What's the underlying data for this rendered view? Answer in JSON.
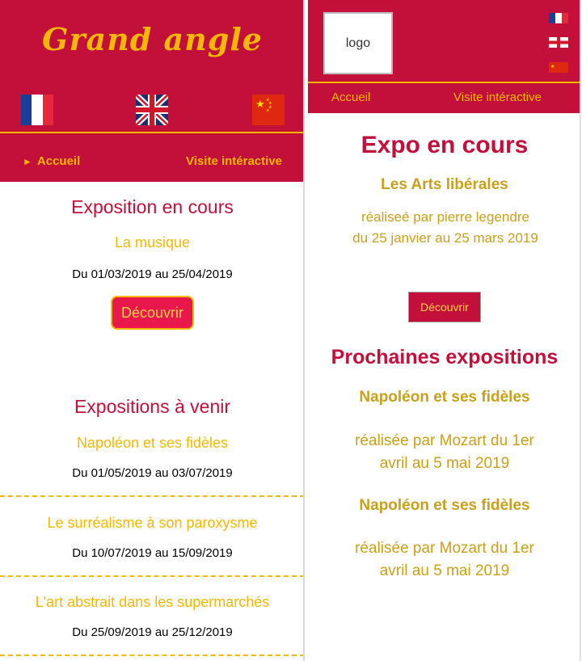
{
  "left": {
    "brand": "Grand angle",
    "flags": [
      "french-flag",
      "uk-flag",
      "china-flag"
    ],
    "nav": {
      "home": "Accueil",
      "visit": "Visite intéractive",
      "home_marker": "►"
    },
    "current": {
      "section_title": "Exposition en cours",
      "name": "La musique",
      "dates": "Du 01/03/2019 au 25/04/2019",
      "button": "Découvrir"
    },
    "upcoming": {
      "section_title": "Expositions à venir",
      "items": [
        {
          "name": "Napoléon et ses fidèles",
          "dates": "Du 01/05/2019 au 03/07/2019"
        },
        {
          "name": "Le surréalisme à son paroxysme",
          "dates": "Du 10/07/2019 au 15/09/2019"
        },
        {
          "name": "L'art abstrait dans les supermarchés",
          "dates": "Du 25/09/2019 au 25/12/2019"
        }
      ]
    }
  },
  "right": {
    "logo": "logo",
    "flags": [
      "french-flag",
      "england-flag",
      "china-flag"
    ],
    "nav": {
      "home": "Accueil",
      "visit": "Visite intéractive"
    },
    "current": {
      "section_title": "Expo en cours",
      "name": "Les Arts libérales",
      "description": "réaliseé par pierre legendre du 25 janvier au 25 mars 2019",
      "button": "Découvrir"
    },
    "upcoming": {
      "section_title": "Prochaines expositions",
      "items": [
        {
          "name": "Napoléon et ses fidèles",
          "description": "réalisée par Mozart du 1er avril au 5 mai 2019"
        },
        {
          "name": "Napoléon et ses fidèles",
          "description": "réalisée par Mozart du 1er avril au 5 mai 2019"
        }
      ]
    }
  },
  "colors": {
    "crimson": "#c2103b",
    "gold": "#f5b800",
    "dark_gold": "#c9a01a",
    "button_pink": "#e8184d"
  }
}
